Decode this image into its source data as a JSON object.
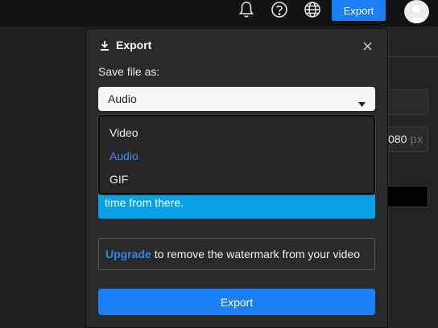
{
  "topbar": {
    "bell_icon": "bell-icon",
    "help_icon": "help-circle-icon",
    "language_icon": "globe-icon",
    "export_label": "Export",
    "avatar_icon": "user-avatar-icon"
  },
  "right_panel": {
    "width_value": "080",
    "width_unit": "px"
  },
  "modal": {
    "title": "Export",
    "title_icon": "download-icon",
    "close_icon": "close-icon",
    "save_label": "Save file as:",
    "select": {
      "value": "Audio",
      "caret_icon": "caret-down-icon"
    },
    "options": [
      {
        "label": "Video",
        "selected": false
      },
      {
        "label": "Audio",
        "selected": true
      },
      {
        "label": "GIF",
        "selected": false
      }
    ],
    "info_text": "time from there.",
    "watermark": {
      "link": "Upgrade",
      "text": "to remove the watermark from your video"
    },
    "export_button": "Export"
  },
  "colors": {
    "accent": "#1a7ff5",
    "info": "#08a0e6",
    "selected_option": "#3b8cf5"
  }
}
